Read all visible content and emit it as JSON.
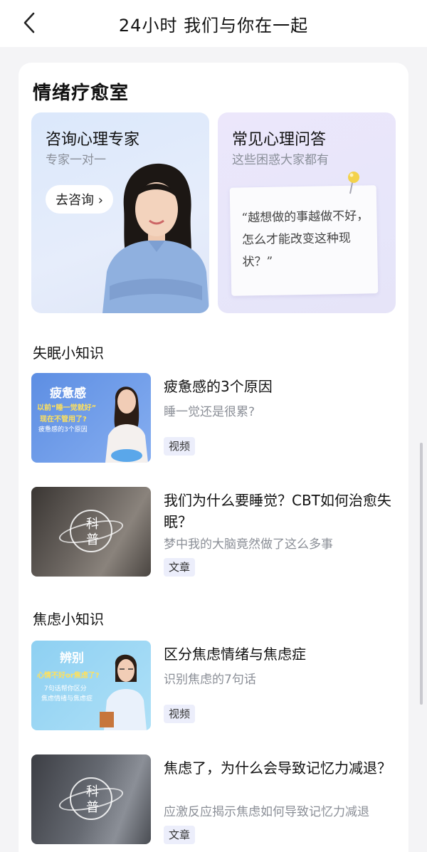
{
  "header": {
    "title": "24小时 我们与你在一起",
    "back_icon": "chevron-left-icon"
  },
  "room": {
    "title": "情绪疗愈室",
    "consult": {
      "title": "咨询心理专家",
      "subtitle": "专家一对一",
      "button": "去咨询 ›"
    },
    "faq": {
      "title": "常见心理问答",
      "subtitle": "这些困惑大家都有",
      "note": "“越想做的事越做不好，怎么才能改变这种现状？”"
    }
  },
  "sections": [
    {
      "title": "失眠小知识",
      "items": [
        {
          "title": "疲惫感的3个原因",
          "subtitle": "睡一觉还是很累?",
          "tag": "视频",
          "thumb": {
            "heading": "疲惫感",
            "line1": "以前“睡一觉就好”",
            "line2": "现在不管用了?",
            "line3": "疲惫感的3个原因"
          }
        },
        {
          "title": "我们为什么要睡觉？CBT如何治愈失眠？",
          "subtitle": "梦中我的大脑竟然做了这么多事",
          "tag": "文章",
          "thumb": {
            "badge1": "科",
            "badge2": "普"
          }
        }
      ]
    },
    {
      "title": "焦虑小知识",
      "items": [
        {
          "title": "区分焦虑情绪与焦虑症",
          "subtitle": "识别焦虑的7句话",
          "tag": "视频",
          "thumb": {
            "heading": "辨别",
            "line1": "心情不好or焦虑了?",
            "line2": "7句话帮你区分",
            "line3": "焦虑情绪与焦虑症"
          }
        },
        {
          "title": "焦虑了，为什么会导致记忆力减退？",
          "subtitle": "应激反应揭示焦虑如何导致记忆力减退",
          "tag": "文章",
          "thumb": {
            "badge1": "科",
            "badge2": "普"
          }
        }
      ]
    }
  ],
  "colors": {
    "tag_bg": "#eceefb",
    "accent_yellow": "#f3d24b"
  }
}
